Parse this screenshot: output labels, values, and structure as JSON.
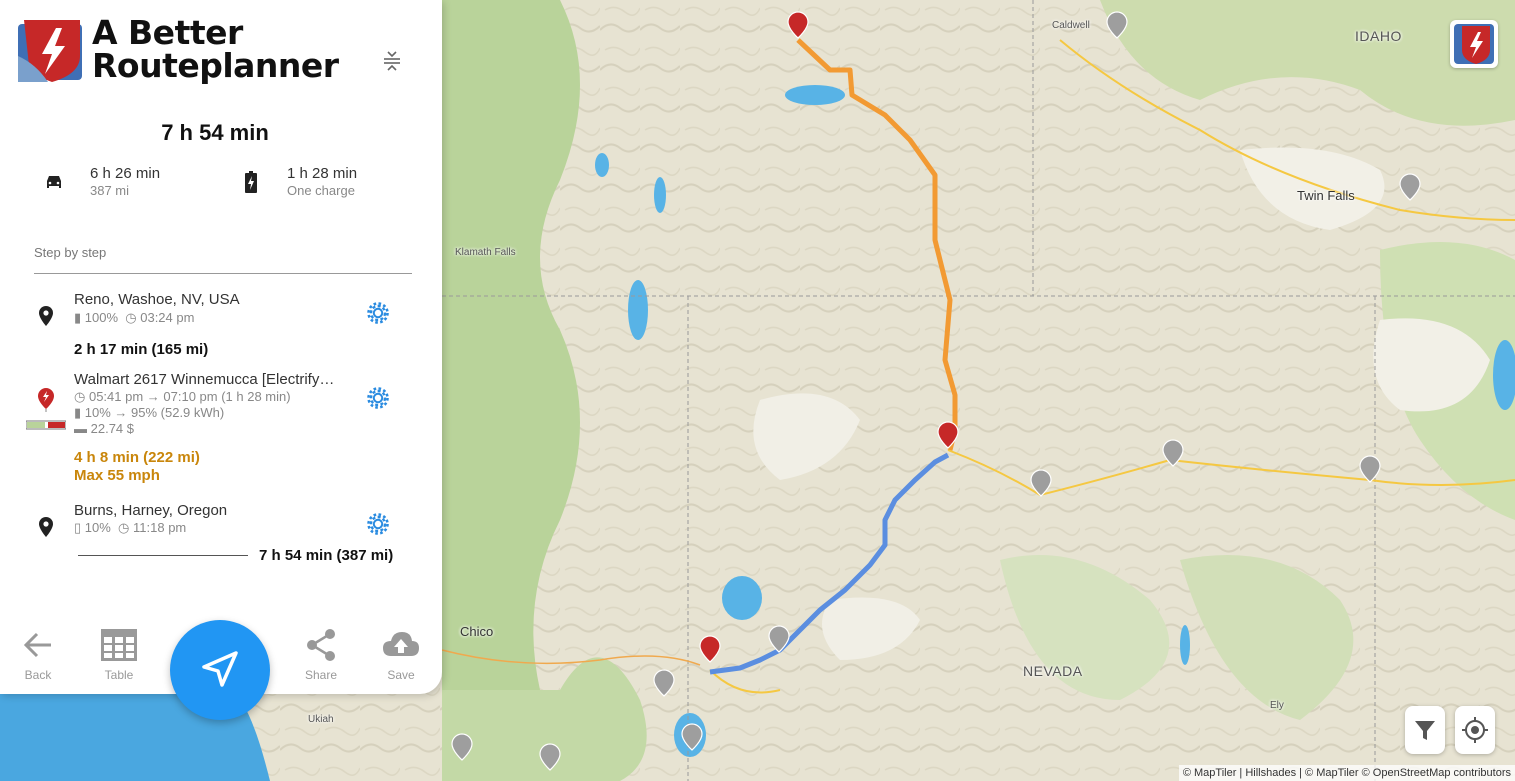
{
  "app": {
    "logo_line1": "A Better",
    "logo_line2": "Routeplanner"
  },
  "summary": {
    "total_time": "7 h 54 min",
    "drive_time": "6 h 26 min",
    "drive_distance": "387 mi",
    "charge_time": "1 h 28 min",
    "charge_count": "One charge"
  },
  "steps": {
    "header": "Step by step",
    "start": {
      "title": "Reno, Washoe, NV, USA",
      "battery": "100%",
      "time": "03:24 pm"
    },
    "leg1": "2 h 17 min (165 mi)",
    "charger": {
      "title": "Walmart 2617 Winnemucca [Electrify…",
      "time": "05:41 pm → 07:10 pm (1 h 28 min)",
      "battery": "10% → 95%  (52.9 kWh)",
      "cost": "22.74 $"
    },
    "leg2": "4 h 8 min (222 mi)",
    "leg2_speed": "Max 55 mph",
    "end": {
      "title": "Burns, Harney, Oregon",
      "battery": "10%",
      "time": "11:18 pm"
    },
    "total": "7 h 54 min (387 mi)"
  },
  "bottom_nav": {
    "back": "Back",
    "table": "Table",
    "share": "Share",
    "save": "Save"
  },
  "map": {
    "labels": {
      "caldwell": "Caldwell",
      "idaho": "IDAHO",
      "twin_falls": "Twin Falls",
      "klamath_falls": "Klamath Falls",
      "chico": "Chico",
      "nevada": "NEVADA",
      "ukiah": "Ukiah",
      "ely": "Ely"
    },
    "attribution": "© MapTiler | Hillshades | © MapTiler © OpenStreetMap contributors",
    "route_colors": {
      "leg1": "#5b8ee0",
      "leg2": "#f29a33"
    },
    "icons": [
      "charger-pin-icon",
      "destination-pin-icon",
      "filter-icon",
      "locate-icon"
    ]
  },
  "colors": {
    "accent": "#2196f3",
    "gear": "#2a8be0",
    "leg_warning": "#c9860b",
    "brand_red": "#c62828"
  }
}
